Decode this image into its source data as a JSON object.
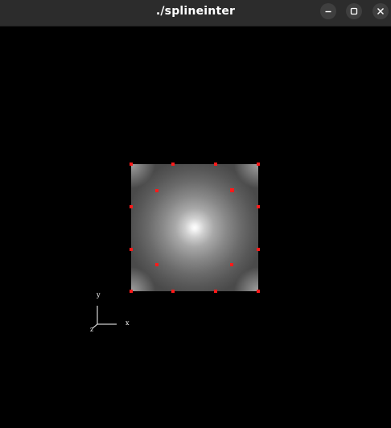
{
  "window": {
    "title": "./splineinter",
    "controls": {
      "minimize_icon": "minimize-icon",
      "maximize_icon": "maximize-icon",
      "close_icon": "close-icon"
    }
  },
  "scene": {
    "background_color": "#000000",
    "surface_color_center": "#ffffff",
    "surface_color_edge": "#4a4a4a",
    "control_point_color": "#ff1a1a"
  },
  "axes": {
    "x_label": "x",
    "y_label": "y",
    "z_label": "z"
  }
}
